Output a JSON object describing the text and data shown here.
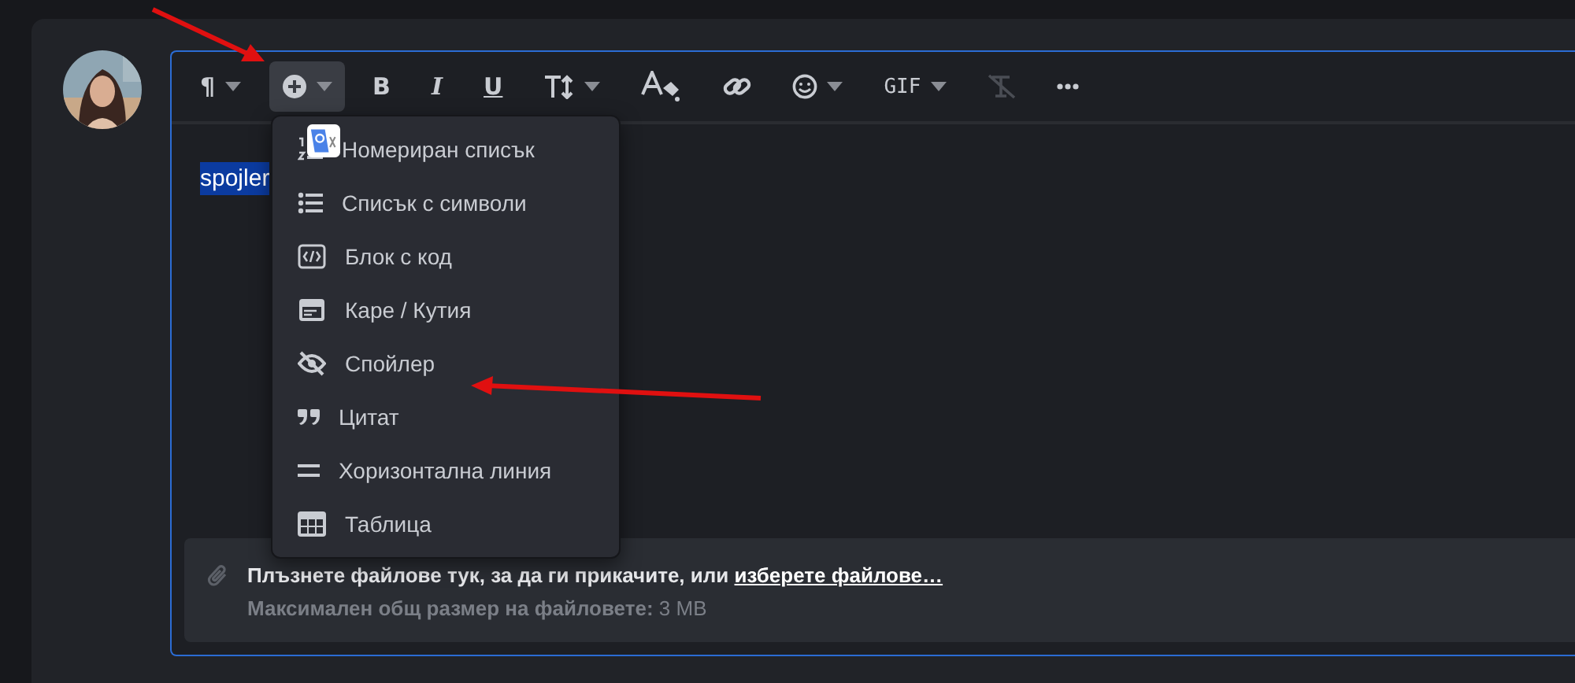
{
  "toolbar": [
    {
      "kind": "text",
      "label": "¶",
      "dropdown": true,
      "selected": false,
      "disabled": false
    },
    {
      "kind": "insert",
      "dropdown": true,
      "selected": true,
      "disabled": false
    },
    {
      "kind": "text",
      "label": "B",
      "dropdown": false,
      "selected": false,
      "disabled": false
    },
    {
      "kind": "text",
      "label": "I",
      "dropdown": false,
      "selected": false,
      "disabled": false
    },
    {
      "kind": "text",
      "label": "U",
      "dropdown": false,
      "selected": false,
      "disabled": false
    },
    {
      "kind": "text-size",
      "dropdown": true,
      "selected": false,
      "disabled": false
    },
    {
      "kind": "text-color",
      "dropdown": false,
      "selected": false,
      "disabled": false
    },
    {
      "kind": "link",
      "dropdown": false,
      "selected": false,
      "disabled": false
    },
    {
      "kind": "emoji",
      "dropdown": true,
      "selected": false,
      "disabled": false
    },
    {
      "kind": "text",
      "label": "GIF",
      "dropdown": true,
      "selected": false,
      "disabled": false
    },
    {
      "kind": "clear-format",
      "dropdown": false,
      "selected": false,
      "disabled": true
    },
    {
      "kind": "more",
      "dropdown": false,
      "selected": false,
      "disabled": false
    }
  ],
  "content": {
    "text": "spojler",
    "selected": true
  },
  "insert_menu": [
    {
      "kind": "numbered",
      "label": "Номериран списък"
    },
    {
      "kind": "bulleted",
      "label": "Списък с символи"
    },
    {
      "kind": "code",
      "label": "Блок с код"
    },
    {
      "kind": "box",
      "label": "Каре / Кутия"
    },
    {
      "kind": "spoiler",
      "label": "Спойлер"
    },
    {
      "kind": "quote",
      "label": "Цитат"
    },
    {
      "kind": "rule",
      "label": "Хоризонтална линия"
    },
    {
      "kind": "table",
      "label": "Таблица"
    }
  ],
  "attachments": {
    "prompt": "Плъзнете файлове тук, за да ги прикачите, или",
    "link": "изберете файлове…",
    "limit": "**Максимален общ размер на файловете:** 3 MB"
  }
}
